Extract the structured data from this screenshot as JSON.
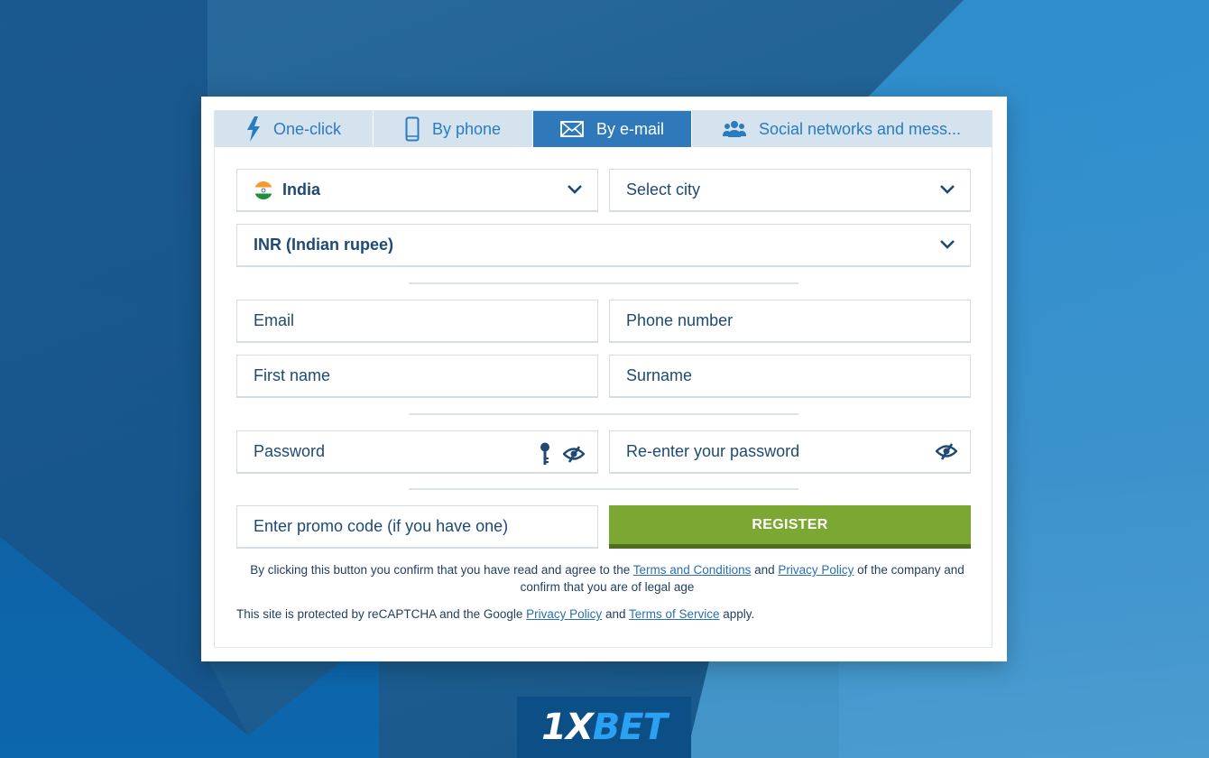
{
  "tabs": [
    {
      "label": "One-click",
      "icon": "lightning-icon",
      "active": false
    },
    {
      "label": "By phone",
      "icon": "phone-icon",
      "active": false
    },
    {
      "label": "By e-mail",
      "icon": "envelope-icon",
      "active": true
    },
    {
      "label": "Social networks and mess...",
      "icon": "users-icon",
      "active": false
    }
  ],
  "form": {
    "country": {
      "value": "India",
      "icon": "india-flag-icon"
    },
    "city": {
      "placeholder": "Select city"
    },
    "currency": {
      "value": "INR (Indian rupee)"
    },
    "email": {
      "placeholder": "Email"
    },
    "phone": {
      "placeholder": "Phone number"
    },
    "first_name": {
      "placeholder": "First name"
    },
    "surname": {
      "placeholder": "Surname"
    },
    "password": {
      "placeholder": "Password"
    },
    "password_repeat": {
      "placeholder": "Re-enter your password"
    },
    "promo": {
      "placeholder": "Enter promo code (if you have one)"
    },
    "register_label": "REGISTER"
  },
  "legal": {
    "line1_pre": "By clicking this button you confirm that you have read and agree to the ",
    "terms_link": "Terms and Conditions",
    "and1": " and ",
    "privacy_link": "Privacy Policy",
    "line1_post": " of the company and confirm that you are of legal age",
    "recaptcha_pre": "This site is protected by reCAPTCHA and the Google ",
    "recaptcha_privacy": "Privacy Policy",
    "and2": " and ",
    "recaptcha_terms": "Terms of Service",
    "recaptcha_post": " apply."
  },
  "brand": {
    "logo_white": "1X",
    "logo_blue": "BET"
  },
  "colors": {
    "accent": "#2f78b9",
    "register": "#7ba832",
    "text": "#1e4a73"
  }
}
